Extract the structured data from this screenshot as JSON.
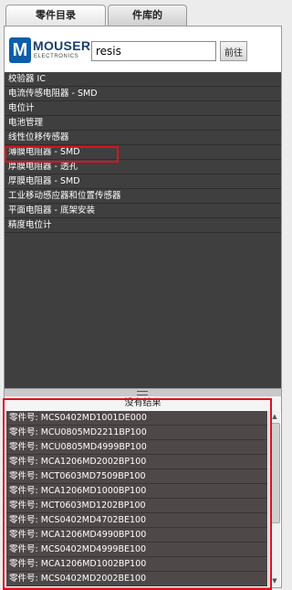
{
  "tabs": [
    {
      "label": "零件目录"
    },
    {
      "label": "件库的"
    }
  ],
  "search": {
    "value": "resis",
    "button_label": "前往"
  },
  "logo": {
    "mark": "M",
    "name": "MOUSER",
    "sub": "ELECTRONICS"
  },
  "categories": [
    {
      "label": "校验器 IC"
    },
    {
      "label": "电流传感电阻器 - SMD"
    },
    {
      "label": "电位计"
    },
    {
      "label": "电池管理"
    },
    {
      "label": "线性位移传感器"
    },
    {
      "label": "薄膜电阻器 - SMD",
      "highlighted": true
    },
    {
      "label": "厚膜电阻器 - 透孔"
    },
    {
      "label": "厚膜电阻器 - SMD"
    },
    {
      "label": "工业移动感应器和位置传感器"
    },
    {
      "label": "平面电阻器 - 底架安装"
    },
    {
      "label": "精度电位计"
    }
  ],
  "results": {
    "header": "没有结果",
    "items": [
      {
        "label": "零件号: MCS0402MD1001DE000"
      },
      {
        "label": "零件号: MCU0805MD2211BP100"
      },
      {
        "label": "零件号: MCU0805MD4999BP100"
      },
      {
        "label": "零件号: MCA1206MD2002BP100"
      },
      {
        "label": "零件号: MCT0603MD7509BP100"
      },
      {
        "label": "零件号: MCA1206MD1000BP100"
      },
      {
        "label": "零件号: MCT0603MD1202BP100"
      },
      {
        "label": "零件号: MCS0402MD4702BE100"
      },
      {
        "label": "零件号: MCA1206MD4990BP100"
      },
      {
        "label": "零件号: MCS0402MD4999BE100"
      },
      {
        "label": "零件号: MCA1206MD1002BP100"
      },
      {
        "label": "零件号: MCS0402MD2002BE100"
      }
    ]
  },
  "colors": {
    "highlight": "#e0101a",
    "category_bg": "#3f3f3f",
    "results_bg": "#4f4848",
    "logo_blue": "#0b5ea8"
  },
  "icons": {
    "scroll_up": "scroll-up-arrow-icon",
    "scroll_down": "scroll-down-arrow-icon",
    "grip": "resize-grip-icon"
  }
}
